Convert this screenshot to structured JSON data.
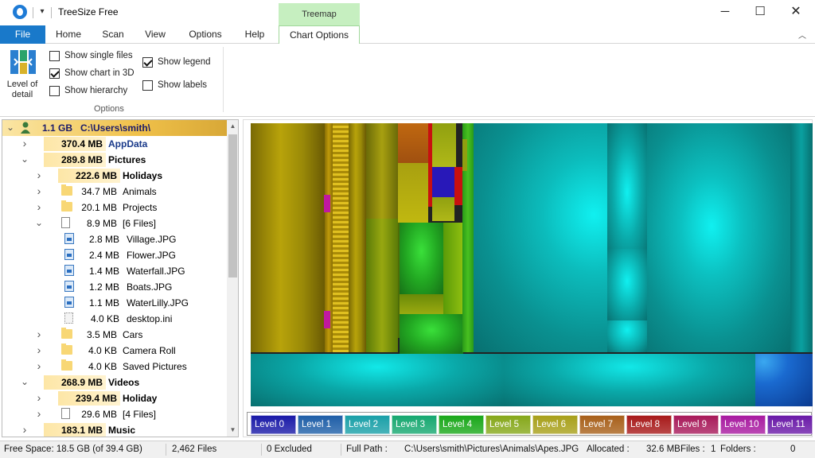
{
  "window": {
    "title": "TreeSize Free",
    "context_tab_group": "Treemap",
    "qa_dropdown": "▾"
  },
  "tabs": [
    "File",
    "Home",
    "Scan",
    "View",
    "Options",
    "Help",
    "Chart Options"
  ],
  "ribbon": {
    "level_of_detail_label": "Level of detail",
    "show_single_files": {
      "label": "Show single files",
      "checked": false
    },
    "show_chart_3d": {
      "label": "Show chart in 3D",
      "checked": true
    },
    "show_hierarchy": {
      "label": "Show hierarchy",
      "checked": false
    },
    "show_legend": {
      "label": "Show legend",
      "checked": true
    },
    "show_labels": {
      "label": "Show labels",
      "checked": false
    },
    "group_label": "Options"
  },
  "tree": {
    "rows": [
      {
        "size": "1.1 GB",
        "name": "C:\\Users\\smith\\",
        "bold": true,
        "indent": 0,
        "expanded": true,
        "icon": "user-icon"
      },
      {
        "size": "370.4 MB",
        "name": "AppData",
        "bold": true,
        "indent": 1,
        "expanded": false,
        "icon": "folder-icon",
        "name_color": "#1a3a8a"
      },
      {
        "size": "289.8 MB",
        "name": "Pictures",
        "bold": true,
        "indent": 1,
        "expanded": true,
        "icon": "folder-icon"
      },
      {
        "size": "222.6 MB",
        "name": "Holidays",
        "bold": true,
        "indent": 2,
        "expanded": false,
        "icon": "folder-icon"
      },
      {
        "size": "34.7 MB",
        "name": "Animals",
        "bold": false,
        "indent": 2,
        "expanded": false,
        "icon": "folder-icon"
      },
      {
        "size": "20.1 MB",
        "name": "Projects",
        "bold": false,
        "indent": 2,
        "expanded": false,
        "icon": "folder-icon"
      },
      {
        "size": "8.9 MB",
        "name": "[6 Files]",
        "bold": false,
        "indent": 2,
        "expanded": true,
        "icon": "files-icon"
      },
      {
        "size": "2.8 MB",
        "name": "Village.JPG",
        "bold": false,
        "indent": 3,
        "expanded": null,
        "icon": "image-icon"
      },
      {
        "size": "2.4 MB",
        "name": "Flower.JPG",
        "bold": false,
        "indent": 3,
        "expanded": null,
        "icon": "image-icon"
      },
      {
        "size": "1.4 MB",
        "name": "Waterfall.JPG",
        "bold": false,
        "indent": 3,
        "expanded": null,
        "icon": "image-icon"
      },
      {
        "size": "1.2 MB",
        "name": "Boats.JPG",
        "bold": false,
        "indent": 3,
        "expanded": null,
        "icon": "image-icon"
      },
      {
        "size": "1.1 MB",
        "name": "WaterLilly.JPG",
        "bold": false,
        "indent": 3,
        "expanded": null,
        "icon": "image-icon"
      },
      {
        "size": "4.0 KB",
        "name": "desktop.ini",
        "bold": false,
        "indent": 3,
        "expanded": null,
        "icon": "ini-file-icon"
      },
      {
        "size": "3.5 MB",
        "name": "Cars",
        "bold": false,
        "indent": 2,
        "expanded": false,
        "icon": "folder-icon"
      },
      {
        "size": "4.0 KB",
        "name": "Camera Roll",
        "bold": false,
        "indent": 2,
        "expanded": false,
        "icon": "folder-icon"
      },
      {
        "size": "4.0 KB",
        "name": "Saved Pictures",
        "bold": false,
        "indent": 2,
        "expanded": false,
        "icon": "folder-icon"
      },
      {
        "size": "268.9 MB",
        "name": "Videos",
        "bold": true,
        "indent": 1,
        "expanded": true,
        "icon": "folder-icon"
      },
      {
        "size": "239.4 MB",
        "name": "Holiday",
        "bold": true,
        "indent": 2,
        "expanded": false,
        "icon": "folder-icon"
      },
      {
        "size": "29.6 MB",
        "name": "[4 Files]",
        "bold": false,
        "indent": 2,
        "expanded": false,
        "icon": "files-icon"
      },
      {
        "size": "183.1 MB",
        "name": "Music",
        "bold": true,
        "indent": 1,
        "expanded": false,
        "icon": "folder-icon"
      }
    ]
  },
  "legend": [
    {
      "label": "Level 0",
      "color": "#1a1aa8"
    },
    {
      "label": "Level 1",
      "color": "#1f5fa8"
    },
    {
      "label": "Level 2",
      "color": "#1aa0a8"
    },
    {
      "label": "Level 3",
      "color": "#16a870"
    },
    {
      "label": "Level 4",
      "color": "#1aa81a"
    },
    {
      "label": "Level 5",
      "color": "#86a81a"
    },
    {
      "label": "Level 6",
      "color": "#a8a01a"
    },
    {
      "label": "Level 7",
      "color": "#a8601a"
    },
    {
      "label": "Level 8",
      "color": "#a81a1a"
    },
    {
      "label": "Level 9",
      "color": "#a81a5a"
    },
    {
      "label": "Level 10",
      "color": "#a81aa0"
    },
    {
      "label": "Level 11",
      "color": "#6a1aa8"
    }
  ],
  "status": {
    "free_space": "Free Space: 18.5 GB  (of 39.4 GB)",
    "files": "2,462  Files",
    "excluded": "0 Excluded",
    "full_path_label": "Full Path :",
    "full_path_value": "C:\\Users\\smith\\Pictures\\Animals\\Apes.JPG",
    "allocated_label": "Allocated :",
    "allocated_value": "32.6 MB",
    "files_label": "Files :",
    "files_value": "1",
    "folders_label": "Folders :",
    "folders_value": "0"
  }
}
